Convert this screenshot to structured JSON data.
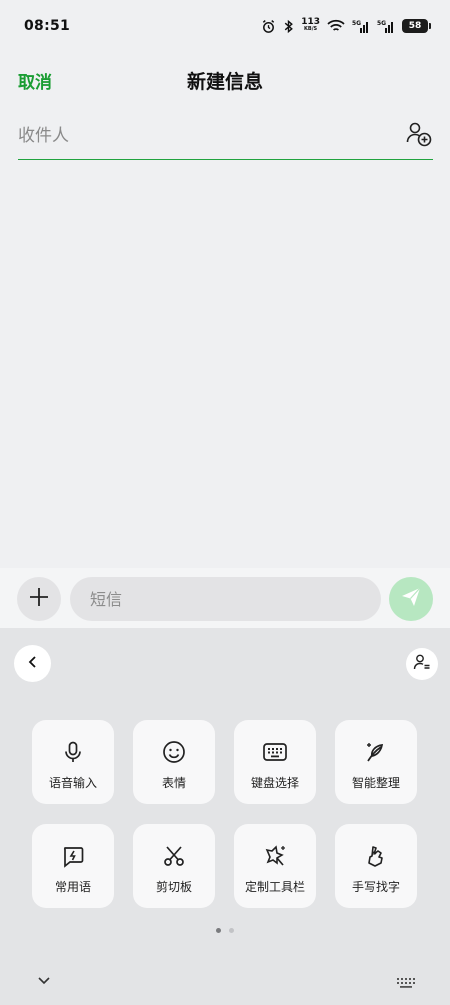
{
  "status": {
    "time": "08:51",
    "speed_value": "113",
    "speed_unit": "KB/S",
    "battery": "58"
  },
  "header": {
    "cancel_label": "取消",
    "title": "新建信息"
  },
  "recipient": {
    "placeholder": "收件人",
    "value": ""
  },
  "compose": {
    "placeholder": "短信",
    "value": ""
  },
  "keyboard": {
    "tools": [
      {
        "label": "语音输入",
        "icon": "microphone-icon"
      },
      {
        "label": "表情",
        "icon": "emoji-icon"
      },
      {
        "label": "键盘选择",
        "icon": "keyboard-icon"
      },
      {
        "label": "智能整理",
        "icon": "feather-sparkle-icon"
      },
      {
        "label": "常用语",
        "icon": "quick-phrase-icon"
      },
      {
        "label": "剪切板",
        "icon": "scissors-icon"
      },
      {
        "label": "定制工具栏",
        "icon": "custom-toolbar-icon"
      },
      {
        "label": "手写找字",
        "icon": "handwriting-icon"
      }
    ],
    "page_count": 2,
    "current_page": 1
  },
  "colors": {
    "accent": "#1a9d33",
    "send_disabled": "#b7e7c1"
  }
}
